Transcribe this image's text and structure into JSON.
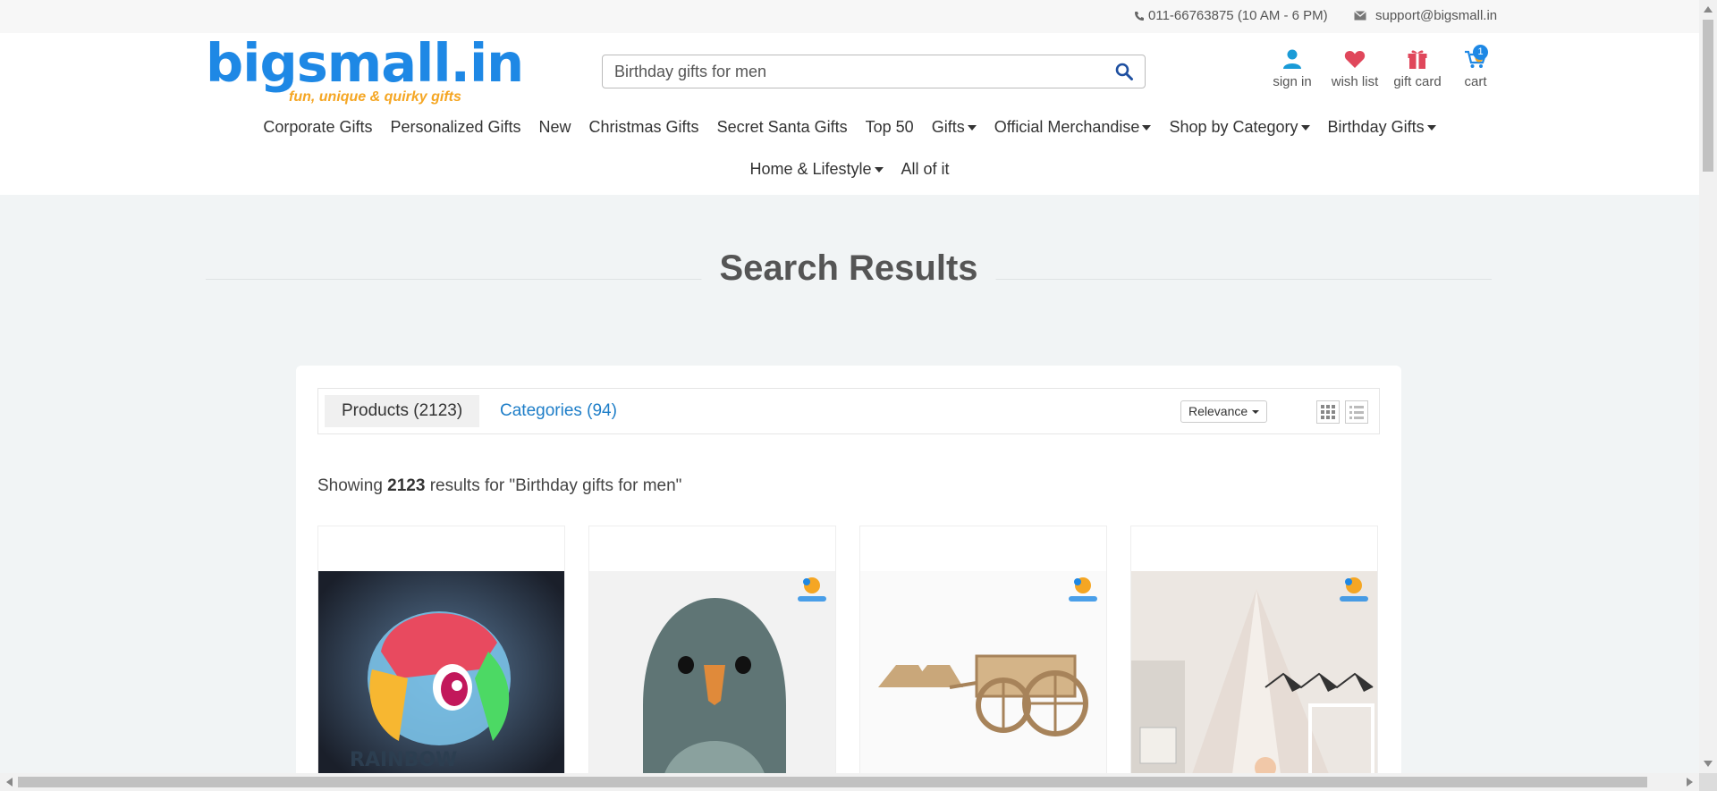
{
  "topbar": {
    "phone": "011-66763875 (10 AM - 6 PM)",
    "email": "support@bigsmall.in"
  },
  "header": {
    "logo_text": "bigsmall.in",
    "logo_tagline": "fun, unique & quirky gifts",
    "search": {
      "value": "Birthday gifts for men"
    },
    "icons": [
      {
        "label": "sign in",
        "icon": "user-icon"
      },
      {
        "label": "wish list",
        "icon": "heart-icon"
      },
      {
        "label": "gift card",
        "icon": "gift-icon"
      },
      {
        "label": "cart",
        "icon": "cart-icon",
        "badge": "1"
      }
    ]
  },
  "nav": {
    "row1": [
      {
        "label": "Corporate Gifts"
      },
      {
        "label": "Personalized Gifts"
      },
      {
        "label": "New"
      },
      {
        "label": "Christmas Gifts"
      },
      {
        "label": "Secret Santa Gifts"
      },
      {
        "label": "Top 50"
      },
      {
        "label": "Gifts",
        "dropdown": true
      },
      {
        "label": "Official Merchandise",
        "dropdown": true
      },
      {
        "label": "Shop by Category",
        "dropdown": true
      },
      {
        "label": "Birthday Gifts",
        "dropdown": true
      }
    ],
    "row2": [
      {
        "label": "Home & Lifestyle",
        "dropdown": true
      },
      {
        "label": "All of it"
      }
    ]
  },
  "main": {
    "title": "Search Results",
    "tabs": [
      {
        "label": "Products (2123)"
      },
      {
        "label": "Categories (94)"
      }
    ],
    "sort_label": "Relevance",
    "showing_prefix": "Showing",
    "showing_count": "2123",
    "showing_suffix": "results for \"Birthday gifts for men\"",
    "products": [
      {
        "image": "rainbow-pony-lamp-image"
      },
      {
        "image": "pigeon-mask-image"
      },
      {
        "image": "wooden-carriage-model-image"
      },
      {
        "image": "kids-teepee-tent-image"
      }
    ]
  },
  "colors": {
    "accent": "#1e88e5",
    "tagline": "#f5a623",
    "link": "#1e7ec8",
    "heart": "#e0475b"
  }
}
